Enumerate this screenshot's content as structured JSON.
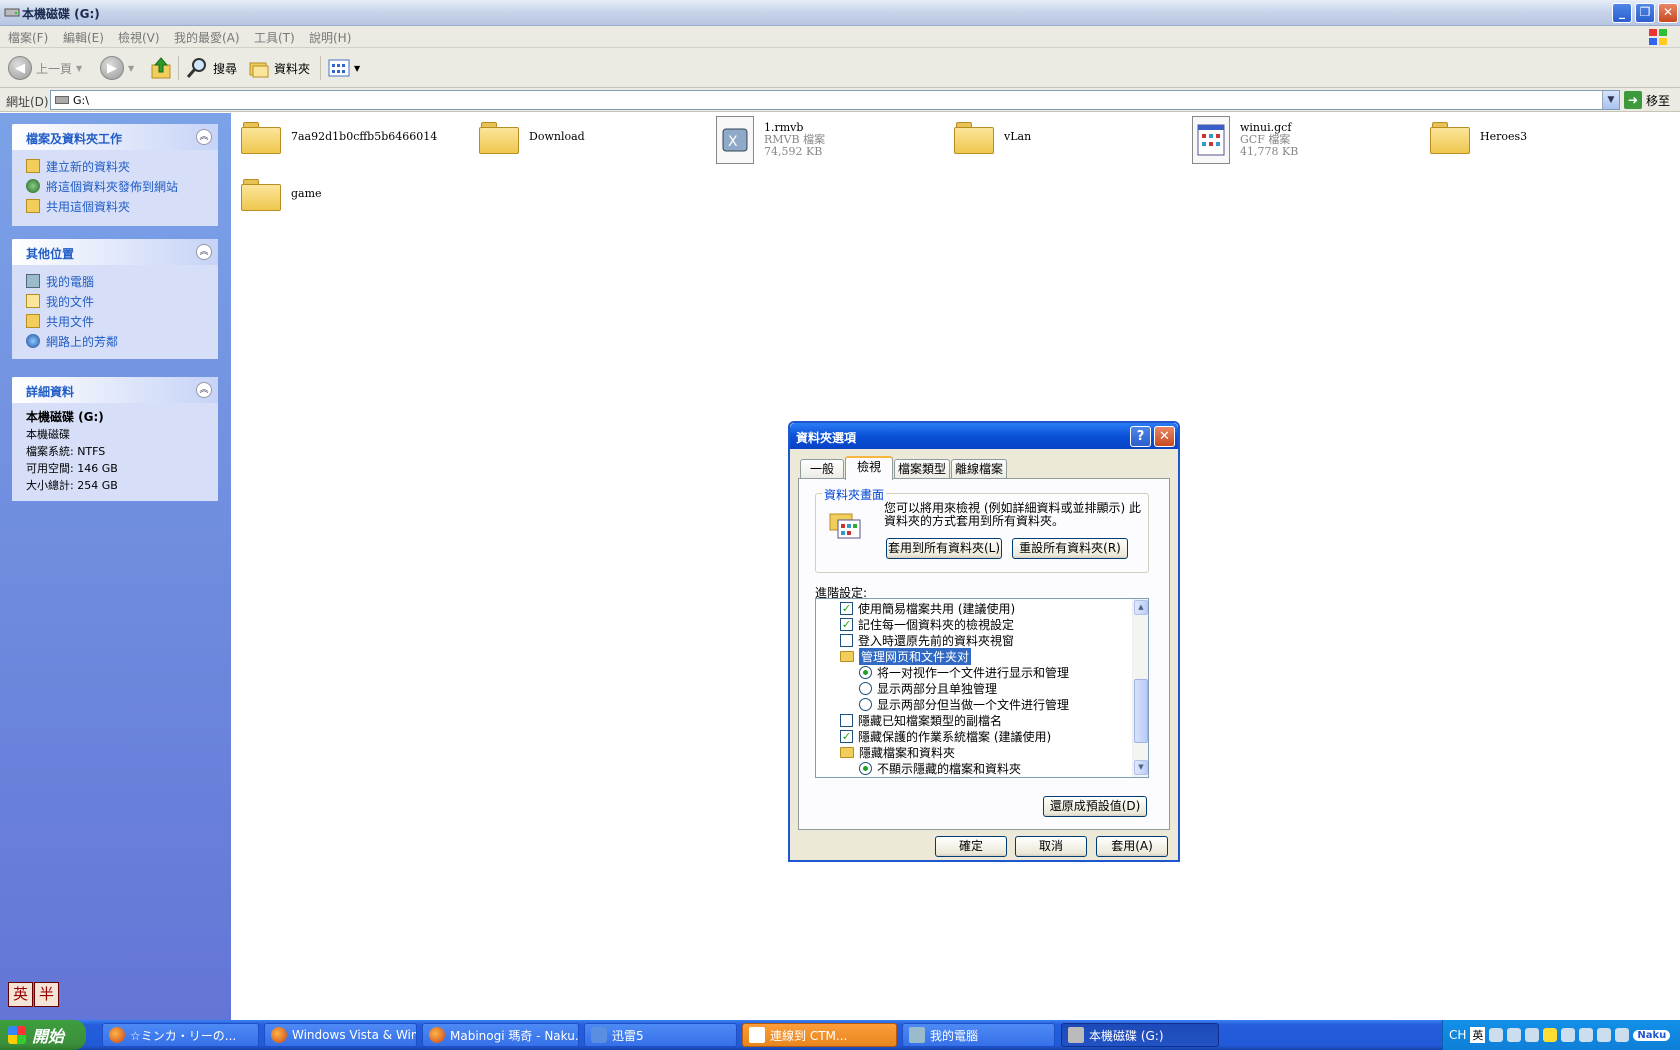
{
  "window": {
    "title": "本機磁碟 (G:)",
    "controls": {
      "minimize": "_",
      "restore": "❐",
      "close": "✕"
    }
  },
  "menubar": [
    "檔案(F)",
    "編輯(E)",
    "檢視(V)",
    "我的最愛(A)",
    "工具(T)",
    "說明(H)"
  ],
  "toolbar": {
    "back": "上一頁",
    "search": "搜尋",
    "folders": "資料夾"
  },
  "address": {
    "label": "網址(D)",
    "value": "G:\\",
    "go": "移至"
  },
  "leftpane": {
    "tasks": {
      "title": "檔案及資料夾工作",
      "items": [
        "建立新的資料夾",
        "將這個資料夾發佈到網站",
        "共用這個資料夾"
      ]
    },
    "places": {
      "title": "其他位置",
      "items": [
        "我的電腦",
        "我的文件",
        "共用文件",
        "網路上的芳鄰"
      ]
    },
    "details": {
      "title": "詳細資料",
      "name": "本機磁碟 (G:)",
      "type": "本機磁碟",
      "fs": "檔案系統: NTFS",
      "free": "可用空間: 146 GB",
      "total": "大小總計: 254 GB"
    }
  },
  "files": [
    {
      "name": "7aa92d1b0cffb5b6466014",
      "kind": "folder"
    },
    {
      "name": "Download",
      "kind": "folder"
    },
    {
      "name": "1.rmvb",
      "type": "RMVB 檔案",
      "size": "74,592 KB",
      "kind": "file"
    },
    {
      "name": "vLan",
      "kind": "folder"
    },
    {
      "name": "winui.gcf",
      "type": "GCF 檔案",
      "size": "41,778 KB",
      "kind": "file"
    },
    {
      "name": "Heroes3",
      "kind": "folder"
    },
    {
      "name": "game",
      "kind": "folder"
    }
  ],
  "dialog": {
    "title": "資料夾選項",
    "help": "?",
    "close": "✕",
    "tabs": [
      "一般",
      "檢視",
      "檔案類型",
      "離線檔案"
    ],
    "group_title": "資料夾畫面",
    "group_text": "您可以將用來檢視 (例如詳細資料或並排顯示) 此資料夾的方式套用到所有資料夾。",
    "apply_all": "套用到所有資料夾(L)",
    "reset_all": "重設所有資料夾(R)",
    "advanced_label": "進階設定:",
    "rows": [
      {
        "kind": "check",
        "checked": true,
        "text": "使用簡易檔案共用 (建議使用)"
      },
      {
        "kind": "check",
        "checked": true,
        "text": "記住每一個資料夾的檢視設定"
      },
      {
        "kind": "check",
        "checked": false,
        "text": "登入時還原先前的資料夾視窗"
      },
      {
        "kind": "folder",
        "selected": true,
        "text": "管理网页和文件夹对"
      },
      {
        "kind": "radio",
        "checked": true,
        "text": "将一对视作一个文件进行显示和管理"
      },
      {
        "kind": "radio",
        "checked": false,
        "text": "显示两部分且单独管理"
      },
      {
        "kind": "radio",
        "checked": false,
        "text": "显示两部分但当做一个文件进行管理"
      },
      {
        "kind": "check",
        "checked": false,
        "text": "隱藏已知檔案類型的副檔名"
      },
      {
        "kind": "check",
        "checked": true,
        "text": "隱藏保護的作業系統檔案 (建議使用)"
      },
      {
        "kind": "folder",
        "selected": false,
        "text": "隱藏檔案和資料夾"
      },
      {
        "kind": "radio",
        "checked": true,
        "text": "不顯示隱藏的檔案和資料夾"
      }
    ],
    "restore_defaults": "還原成預設值(D)",
    "ok": "確定",
    "cancel": "取消",
    "apply": "套用(A)"
  },
  "ime": [
    "英",
    "半"
  ],
  "taskbar": {
    "start": "開始",
    "tasks": [
      "☆ミンカ・リーの...",
      "Windows Vista & Win...",
      "Mabinogi 瑪奇 - Naku...",
      "迅雷5",
      "連線到 CTM...",
      "我的電腦",
      "本機磁碟 (G:)"
    ],
    "tray_lang": "CH",
    "tray_ime": "英",
    "tray_app": "Naku"
  }
}
